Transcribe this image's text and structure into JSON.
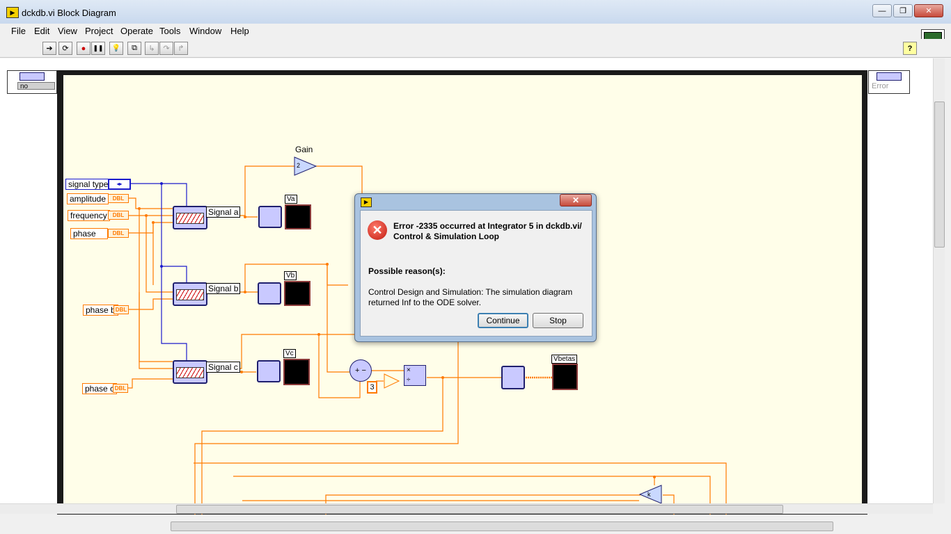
{
  "window": {
    "title": "dckdb.vi Block Diagram",
    "minimize": "—",
    "restore": "❐",
    "close": "✕"
  },
  "menu": [
    "File",
    "Edit",
    "View",
    "Project",
    "Operate",
    "Tools",
    "Window",
    "Help"
  ],
  "toolbar": {
    "run": "➔",
    "run_continuous": "⟳",
    "abort": "●",
    "pause": "❚❚",
    "highlight": "💡",
    "retain": "⧉",
    "step_into": "↳",
    "step_over": "↷",
    "step_out": "↱",
    "help": "?"
  },
  "diagram": {
    "left_terminal_value": "no",
    "right_terminal_value": "Error",
    "gain_label": "Gain",
    "gain_value": "2",
    "controls": {
      "signal_type": "signal type",
      "amplitude": "amplitude",
      "frequency": "frequency",
      "phase": "phase",
      "phase_b": "phase b",
      "phase_c": "phase c",
      "dbl": "DBL"
    },
    "signals": {
      "a": "Signal a",
      "b": "Signal b",
      "c": "Signal c"
    },
    "graphs": {
      "va": "Va",
      "vb": "Vb",
      "vc": "Vc",
      "vbetas": "Vbetas"
    },
    "const_three": "3",
    "const_k": "k"
  },
  "dialog": {
    "error_title": "Error -2335 occurred at Integrator 5 in dckdb.vi/\nControl & Simulation Loop",
    "reason_heading": "Possible reason(s):",
    "reason_text": "Control Design and Simulation:  The simulation diagram returned Inf to the ODE solver.",
    "continue_label": "Continue",
    "stop_label": "Stop",
    "close": "✕"
  },
  "colors": {
    "wire_orange": "#ff7a00",
    "wire_blue": "#1a1acc",
    "loop_frame": "#1a1a1a",
    "loop_bg": "#fffee9",
    "error_red": "#d32f2f"
  }
}
